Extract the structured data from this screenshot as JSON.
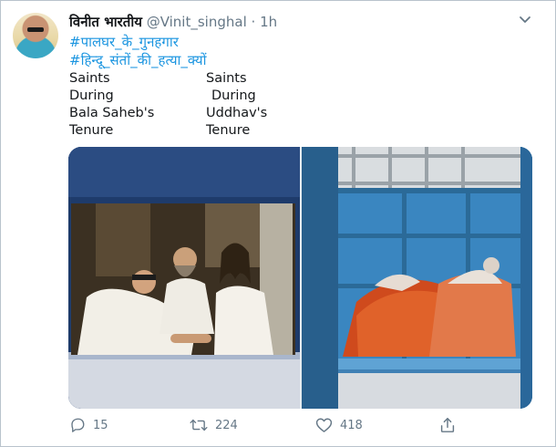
{
  "tweet": {
    "author_name": "विनीत भारतीय",
    "author_handle": "@Vinit_singhal",
    "separator": "·",
    "time": "1h",
    "hashtags": [
      "#पालघर_के_गुनहगार",
      "#हिन्दू_संतों_की_हत्या_क्यों"
    ],
    "left_column": [
      "Saints",
      "During",
      "Bala Saheb's",
      "Tenure"
    ],
    "right_column": [
      "Saints",
      "During",
      "Uddhav's",
      "Tenure"
    ]
  },
  "actions": {
    "reply_count": "15",
    "retweet_count": "224",
    "like_count": "418"
  },
  "colors": {
    "link": "#1b95e0",
    "muted": "#657786",
    "text": "#14171a"
  },
  "icons": [
    "avatar",
    "chevron-down-icon",
    "reply-icon",
    "retweet-icon",
    "like-icon",
    "share-icon"
  ]
}
